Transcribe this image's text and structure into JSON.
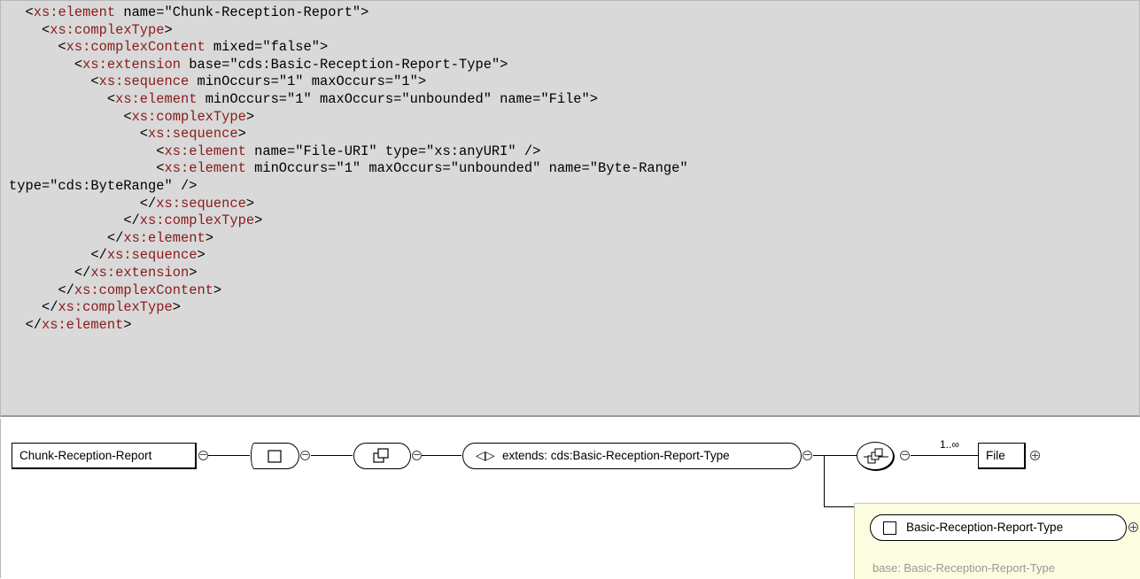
{
  "code": {
    "lines": [
      {
        "indent": "  ",
        "parts": [
          {
            "t": "<"
          },
          {
            "t": "xs:element",
            "tag": true
          },
          {
            "t": " name=\"Chunk-Reception-Report\">"
          }
        ]
      },
      {
        "indent": "    ",
        "parts": [
          {
            "t": "<"
          },
          {
            "t": "xs:complexType",
            "tag": true
          },
          {
            "t": ">"
          }
        ]
      },
      {
        "indent": "      ",
        "parts": [
          {
            "t": "<"
          },
          {
            "t": "xs:complexContent",
            "tag": true
          },
          {
            "t": " mixed=\"false\">"
          }
        ]
      },
      {
        "indent": "        ",
        "parts": [
          {
            "t": "<"
          },
          {
            "t": "xs:extension",
            "tag": true
          },
          {
            "t": " base=\"cds:Basic-Reception-Report-Type\">"
          }
        ]
      },
      {
        "indent": "          ",
        "parts": [
          {
            "t": "<"
          },
          {
            "t": "xs:sequence",
            "tag": true
          },
          {
            "t": " minOccurs=\"1\" maxOccurs=\"1\">"
          }
        ]
      },
      {
        "indent": "            ",
        "parts": [
          {
            "t": "<"
          },
          {
            "t": "xs:element",
            "tag": true
          },
          {
            "t": " minOccurs=\"1\" maxOccurs=\"unbounded\" name=\"File\">"
          }
        ]
      },
      {
        "indent": "              ",
        "parts": [
          {
            "t": "<"
          },
          {
            "t": "xs:complexType",
            "tag": true
          },
          {
            "t": ">"
          }
        ]
      },
      {
        "indent": "                ",
        "parts": [
          {
            "t": "<"
          },
          {
            "t": "xs:sequence",
            "tag": true
          },
          {
            "t": ">"
          }
        ]
      },
      {
        "indent": "                  ",
        "parts": [
          {
            "t": "<"
          },
          {
            "t": "xs:element",
            "tag": true
          },
          {
            "t": " name=\"File-URI\" type=\"xs:anyURI\" />"
          }
        ]
      },
      {
        "indent": "                  ",
        "parts": [
          {
            "t": "<"
          },
          {
            "t": "xs:element",
            "tag": true
          },
          {
            "t": " minOccurs=\"1\" maxOccurs=\"unbounded\" name=\"Byte-Range\""
          }
        ]
      },
      {
        "indent": "",
        "parts": [
          {
            "t": "type=\"cds:ByteRange\" />"
          }
        ]
      },
      {
        "indent": "                ",
        "parts": [
          {
            "t": "</"
          },
          {
            "t": "xs:sequence",
            "tag": true
          },
          {
            "t": ">"
          }
        ]
      },
      {
        "indent": "              ",
        "parts": [
          {
            "t": "</"
          },
          {
            "t": "xs:complexType",
            "tag": true
          },
          {
            "t": ">"
          }
        ]
      },
      {
        "indent": "            ",
        "parts": [
          {
            "t": "</"
          },
          {
            "t": "xs:element",
            "tag": true
          },
          {
            "t": ">"
          }
        ]
      },
      {
        "indent": "          ",
        "parts": [
          {
            "t": "</"
          },
          {
            "t": "xs:sequence",
            "tag": true
          },
          {
            "t": ">"
          }
        ]
      },
      {
        "indent": "        ",
        "parts": [
          {
            "t": "</"
          },
          {
            "t": "xs:extension",
            "tag": true
          },
          {
            "t": ">"
          }
        ]
      },
      {
        "indent": "      ",
        "parts": [
          {
            "t": "</"
          },
          {
            "t": "xs:complexContent",
            "tag": true
          },
          {
            "t": ">"
          }
        ]
      },
      {
        "indent": "    ",
        "parts": [
          {
            "t": "</"
          },
          {
            "t": "xs:complexType",
            "tag": true
          },
          {
            "t": ">"
          }
        ]
      },
      {
        "indent": "  ",
        "parts": [
          {
            "t": "</"
          },
          {
            "t": "xs:element",
            "tag": true
          },
          {
            "t": ">"
          }
        ]
      }
    ]
  },
  "diagram": {
    "root_element": "Chunk-Reception-Report",
    "extension_label": "extends: cds:Basic-Reception-Report-Type",
    "occurrence": "1..∞",
    "file_element": "File",
    "base_type_name": "Basic-Reception-Report-Type",
    "base_caption": "base: Basic-Reception-Report-Type",
    "icons": {
      "collapse": "⊖",
      "expand": "⊕"
    }
  }
}
